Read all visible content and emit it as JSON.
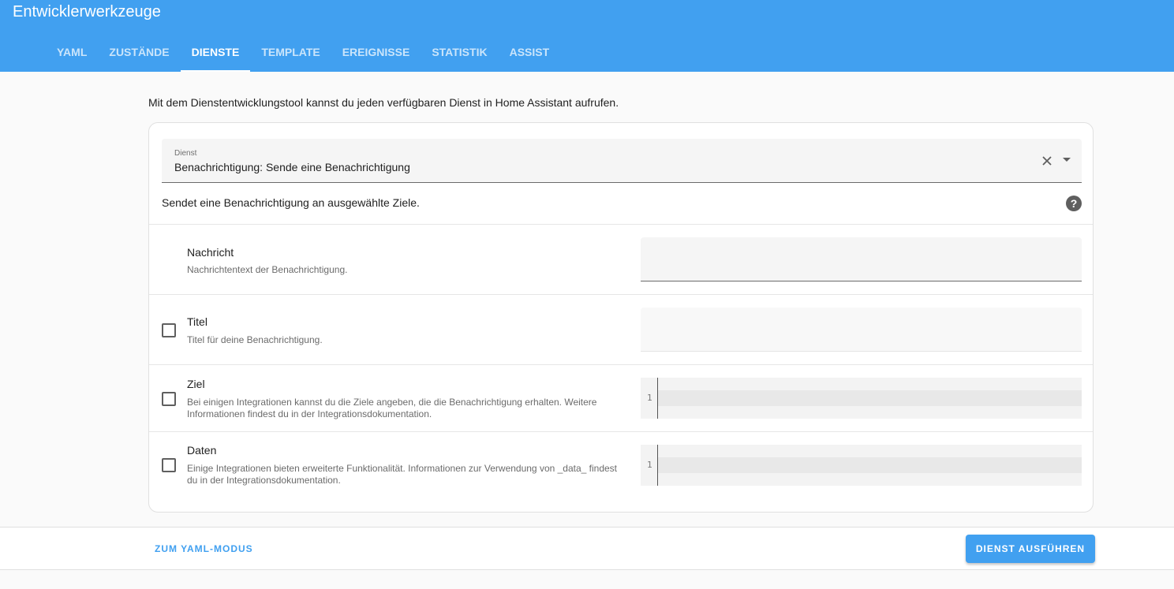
{
  "header": {
    "title": "Entwicklerwerkzeuge",
    "tabs": [
      {
        "label": "YAML"
      },
      {
        "label": "ZUSTÄNDE"
      },
      {
        "label": "DIENSTE",
        "active": true
      },
      {
        "label": "TEMPLATE"
      },
      {
        "label": "EREIGNISSE"
      },
      {
        "label": "STATISTIK"
      },
      {
        "label": "ASSIST"
      }
    ],
    "background_color": "#41a0f0"
  },
  "main": {
    "intro": "Mit dem Dienstentwicklungstool kannst du jeden verfügbaren Dienst in Home Assistant aufrufen.",
    "service_select": {
      "label": "Dienst",
      "value": "Benachrichtigung: Sende eine Benachrichtigung",
      "clear_icon": "close-icon",
      "dropdown_icon": "arrow-drop-down-icon"
    },
    "description": "Sendet eine Benachrichtigung an ausgewählte Ziele.",
    "help_icon": "help-circle-icon",
    "fields": [
      {
        "title": "Nachricht",
        "description": "Nachrichtentext der Benachrichtigung.",
        "has_checkbox": false,
        "input": "text"
      },
      {
        "title": "Titel",
        "description": "Titel für deine Benachrichtigung.",
        "has_checkbox": true,
        "checked": false,
        "input": "text"
      },
      {
        "title": "Ziel",
        "description": "Bei einigen Integrationen kannst du die Ziele angeben, die die Benachrichtigung erhalten. Weitere Informationen findest du in der Integrationsdokumentation.",
        "has_checkbox": true,
        "checked": false,
        "input": "code",
        "line_number": "1"
      },
      {
        "title": "Daten",
        "description": "Einige Integrationen bieten erweiterte Funktionalität. Informationen zur Verwendung von _data_ findest du in der Integrationsdokumentation.",
        "has_checkbox": true,
        "checked": false,
        "input": "code",
        "line_number": "1"
      }
    ]
  },
  "footer": {
    "yaml_mode_label": "ZUM YAML-MODUS",
    "run_label": "DIENST AUSFÜHREN",
    "accent_color": "#41a0f0"
  }
}
